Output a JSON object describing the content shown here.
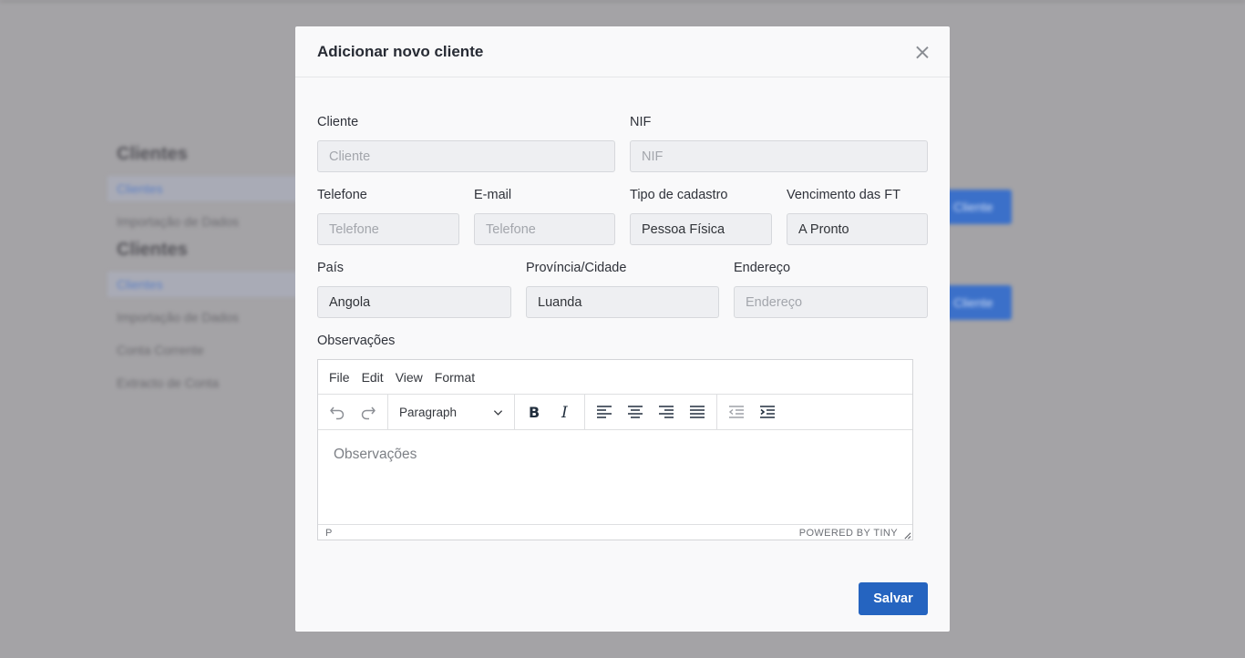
{
  "background": {
    "section1_title": "Clientes",
    "section1_items": [
      "Clientes",
      "Importação de Dados"
    ],
    "section2_title": "Clientes",
    "section2_items": [
      "Clientes",
      "Importação de Dados",
      "Conta Corrente",
      "Extracto de Conta"
    ],
    "button1": "Cliente",
    "button2": "Cliente"
  },
  "modal": {
    "title": "Adicionar novo cliente",
    "save_label": "Salvar"
  },
  "fields": {
    "cliente": {
      "label": "Cliente",
      "placeholder": "Cliente",
      "value": ""
    },
    "nif": {
      "label": "NIF",
      "placeholder": "NIF",
      "value": ""
    },
    "telefone": {
      "label": "Telefone",
      "placeholder": "Telefone",
      "value": ""
    },
    "email": {
      "label": "E-mail",
      "placeholder": "Telefone",
      "value": ""
    },
    "tipo_cadastro": {
      "label": "Tipo de cadastro",
      "value": "Pessoa Física"
    },
    "vencimento": {
      "label": "Vencimento das FT",
      "value": "A Pronto"
    },
    "pais": {
      "label": "País",
      "value": "Angola"
    },
    "provincia": {
      "label": "Província/Cidade",
      "value": "Luanda"
    },
    "endereco": {
      "label": "Endereço",
      "placeholder": "Endereço",
      "value": ""
    },
    "observacoes": {
      "label": "Observações"
    }
  },
  "editor": {
    "menu": [
      "File",
      "Edit",
      "View",
      "Format"
    ],
    "block_format": "Paragraph",
    "placeholder": "Observações",
    "path": "P",
    "branding": "POWERED BY TINY"
  },
  "icons": {
    "close": "close-icon",
    "undo": "undo-icon",
    "redo": "redo-icon",
    "bold": "bold-icon",
    "italic": "italic-icon",
    "align_left": "align-left-icon",
    "align_center": "align-center-icon",
    "align_right": "align-right-icon",
    "align_justify": "align-justify-icon",
    "outdent": "outdent-icon",
    "indent": "indent-icon"
  },
  "colors": {
    "primary": "#2564c0",
    "overlay": "#a4a3a6"
  }
}
